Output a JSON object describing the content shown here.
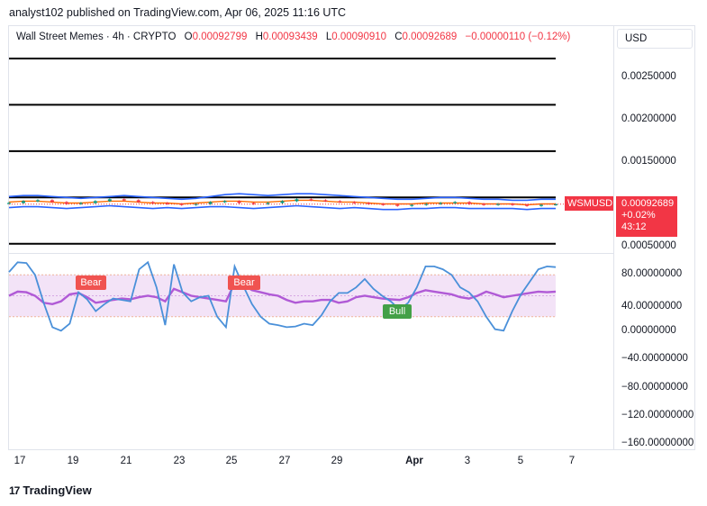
{
  "publisher": "analyst102 published on TradingView.com, Apr 06, 2025 11:16 UTC",
  "legend": {
    "symbol": "Wall Street Memes · 4h · CRYPTO",
    "open_label": "O",
    "open": "0.00092799",
    "high_label": "H",
    "high": "0.00093439",
    "low_label": "L",
    "low": "0.00090910",
    "close_label": "C",
    "close": "0.00092689",
    "change": "−0.00000110 (−0.12%)"
  },
  "currency_button": "USD",
  "price_tag": {
    "symbol": "WSMUSD",
    "price": "0.00092689",
    "change": "+0.02%",
    "countdown": "43:12"
  },
  "brand": {
    "logo": "17",
    "name": "TradingView"
  },
  "colors": {
    "down": "#f23645",
    "up": "#089981",
    "bb": "#2962ff",
    "ma": "#ff6d00",
    "stoch_k": "#4a90d9",
    "stoch_d": "#b05ad6",
    "band_fill": "#f3e3f7"
  },
  "chart_data": [
    {
      "type": "line",
      "name": "price",
      "x_ticks": [
        "17",
        "19",
        "21",
        "23",
        "25",
        "27",
        "29",
        "Apr",
        "3",
        "5",
        "7"
      ],
      "y_ticks": [
        "0.00250000",
        "0.00200000",
        "0.00150000",
        "0.00100000",
        "0.00050000"
      ],
      "ylim": [
        0.0004,
        0.00285
      ],
      "horizontal_lines": [
        0.0025,
        0.002,
        0.0015,
        0.001,
        0.0005
      ],
      "close": [
        0.00094,
        0.00096,
        0.00097,
        0.00095,
        0.00093,
        0.00094,
        0.00096,
        0.00098,
        0.00097,
        0.00095,
        0.00094,
        0.00093,
        0.00092,
        0.00093,
        0.00095,
        0.00096,
        0.00094,
        0.00093,
        0.00094,
        0.00096,
        0.00098,
        0.00097,
        0.00096,
        0.00095,
        0.00094,
        0.00093,
        0.00092,
        0.00091,
        0.00092,
        0.00093,
        0.00094,
        0.00095,
        0.00093,
        0.00092,
        0.00093,
        0.00092,
        0.00091,
        0.00092,
        0.000927
      ],
      "upper_band": [
        0.00101,
        0.00102,
        0.00102,
        0.00101,
        0.001,
        0.00099,
        0.001,
        0.00101,
        0.00102,
        0.00101,
        0.001,
        0.00099,
        0.00098,
        0.00099,
        0.00101,
        0.00103,
        0.00104,
        0.00103,
        0.00102,
        0.00103,
        0.00104,
        0.00104,
        0.00103,
        0.00102,
        0.00101,
        0.001,
        0.00099,
        0.00098,
        0.00098,
        0.00099,
        0.001,
        0.001,
        0.00099,
        0.00098,
        0.00098,
        0.00097,
        0.00097,
        0.00098,
        0.00098
      ],
      "middle_band": [
        0.00095,
        0.00096,
        0.00096,
        0.00095,
        0.00094,
        0.00094,
        0.00095,
        0.00096,
        0.00096,
        0.00095,
        0.00094,
        0.00094,
        0.00093,
        0.00094,
        0.00095,
        0.00096,
        0.00096,
        0.00095,
        0.00095,
        0.00096,
        0.00097,
        0.00097,
        0.00096,
        0.00095,
        0.00095,
        0.00094,
        0.00093,
        0.00093,
        0.00093,
        0.00094,
        0.00094,
        0.00094,
        0.00094,
        0.00093,
        0.00093,
        0.00093,
        0.00092,
        0.00093,
        0.00093
      ],
      "lower_band": [
        0.00089,
        0.0009,
        0.0009,
        0.00089,
        0.00088,
        0.00089,
        0.0009,
        0.00091,
        0.0009,
        0.00089,
        0.00088,
        0.00089,
        0.00088,
        0.00089,
        0.0009,
        0.0009,
        0.00089,
        0.00088,
        0.00089,
        0.0009,
        0.00091,
        0.0009,
        0.00089,
        0.00088,
        0.00089,
        0.00088,
        0.00087,
        0.00087,
        0.00088,
        0.00088,
        0.00089,
        0.00089,
        0.00088,
        0.00088,
        0.00088,
        0.00088,
        0.00087,
        0.00088,
        0.00088
      ]
    },
    {
      "type": "line",
      "name": "stochastic",
      "y_ticks": [
        "80.00000000",
        "40.00000000",
        "0.00000000",
        "−40.00000000",
        "−80.00000000",
        "−120.00000000",
        "−160.00000000"
      ],
      "ylim": [
        -170,
        110
      ],
      "overbought": 80,
      "oversold": 20,
      "k": [
        84,
        98,
        97,
        80,
        40,
        5,
        0,
        10,
        55,
        45,
        28,
        38,
        46,
        44,
        42,
        88,
        98,
        62,
        8,
        95,
        55,
        42,
        48,
        50,
        20,
        5,
        92,
        64,
        38,
        20,
        10,
        8,
        5,
        6,
        10,
        8,
        22,
        42,
        54,
        54,
        62,
        74,
        60,
        50,
        42,
        30,
        40,
        62,
        92,
        92,
        88,
        80,
        62,
        55,
        42,
        20,
        2,
        0,
        28,
        52,
        70,
        88,
        92,
        91
      ],
      "d": [
        50,
        56,
        55,
        50,
        40,
        38,
        42,
        52,
        54,
        48,
        40,
        42,
        44,
        46,
        45,
        48,
        50,
        48,
        42,
        60,
        55,
        50,
        48,
        46,
        44,
        42,
        68,
        66,
        58,
        55,
        52,
        50,
        44,
        40,
        42,
        42,
        44,
        44,
        40,
        42,
        48,
        50,
        48,
        46,
        45,
        44,
        48,
        54,
        58,
        56,
        54,
        52,
        48,
        46,
        50,
        56,
        52,
        48,
        50,
        52,
        54,
        56,
        55,
        56
      ],
      "signals": [
        {
          "label": "Bear",
          "type": "bear"
        },
        {
          "label": "Bear",
          "type": "bear"
        },
        {
          "label": "Bull",
          "type": "bull"
        }
      ]
    }
  ]
}
